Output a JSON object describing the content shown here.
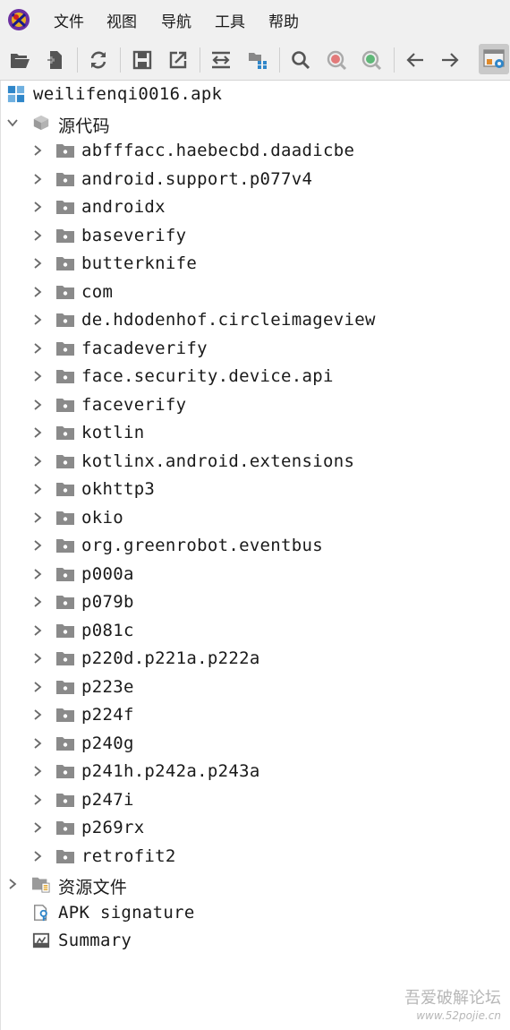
{
  "menu": {
    "items": [
      "文件",
      "视图",
      "导航",
      "工具",
      "帮助"
    ]
  },
  "toolbar": {
    "buttons": [
      "open-folder-icon",
      "add-file-icon",
      "sync-icon",
      "save-icon",
      "export-icon",
      "flatten-packages-icon",
      "sync-tree-icon",
      "search-icon",
      "find-class-icon",
      "find-usage-icon",
      "back-arrow-icon",
      "forward-arrow-icon",
      "preferences-icon"
    ]
  },
  "tree": {
    "root": "weilifenqi0016.apk",
    "source_node": "源代码",
    "packages": [
      "abfffacc.haebecbd.daadicbe",
      "android.support.p077v4",
      "androidx",
      "baseverify",
      "butterknife",
      "com",
      "de.hdodenhof.circleimageview",
      "facadeverify",
      "face.security.device.api",
      "faceverify",
      "kotlin",
      "kotlinx.android.extensions",
      "okhttp3",
      "okio",
      "org.greenrobot.eventbus",
      "p000a",
      "p079b",
      "p081c",
      "p220d.p221a.p222a",
      "p223e",
      "p224f",
      "p240g",
      "p241h.p242a.p243a",
      "p247i",
      "p269rx",
      "retrofit2"
    ],
    "resources_node": "资源文件",
    "signature_node": "APK signature",
    "summary_node": "Summary"
  },
  "watermark": {
    "title": "吾爱破解论坛",
    "url": "www.52pojie.cn"
  },
  "colors": {
    "folder_gray": "#8a8a8a",
    "chevron": "#6a6a6a",
    "accent_blue": "#2f86c9"
  }
}
